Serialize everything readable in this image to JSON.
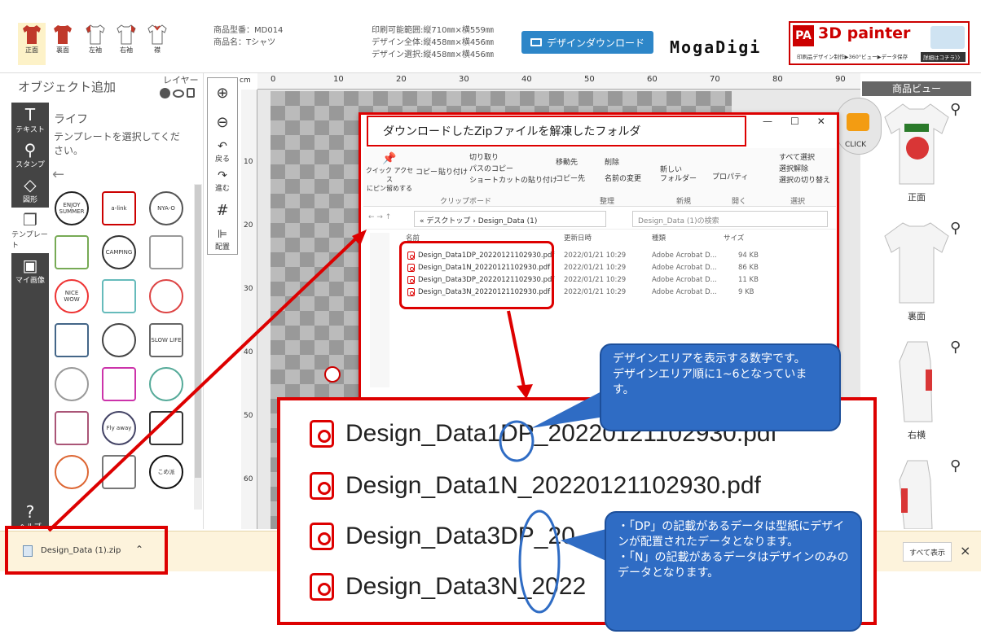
{
  "topbar": {
    "tabs": [
      {
        "label": "正面"
      },
      {
        "label": "裏面"
      },
      {
        "label": "左袖"
      },
      {
        "label": "右袖"
      },
      {
        "label": "襟"
      }
    ],
    "product_code": "商品型番：MD014",
    "product_name": "商品名：Tシャツ",
    "print_area": "印刷可能範囲:縦710㎜×横559㎜",
    "design_total": "デザイン全体:縦458㎜×横456㎜",
    "design_selected": "デザイン選択:縦458㎜×横456㎜",
    "download_button": "デザインダウンロード",
    "logo": "MogaDigi",
    "banner_pa": "PA",
    "banner_title": "3D painter",
    "banner_sub": "印刷品デザイン制作▶360°ビュー▶データ保存",
    "banner_more": "詳細はコチラ〉〉"
  },
  "left": {
    "header": "オブジェクト追加",
    "layer_label": "レイヤー",
    "tools": [
      {
        "label": "テキスト",
        "icon": "T"
      },
      {
        "label": "スタンプ",
        "icon": "⚲"
      },
      {
        "label": "図形",
        "icon": "◇"
      },
      {
        "label": "テンプレート",
        "icon": "❐"
      },
      {
        "label": "マイ画像",
        "icon": "▣"
      }
    ],
    "help_label": "ヘルプ",
    "category": "ライフ",
    "instruction": "テンプレートを選択してください。",
    "templates": [
      "ENJOY SUMMER",
      "a-link",
      "NYA-O",
      "",
      "CAMPING",
      "",
      "NICE WOW",
      "",
      "",
      "",
      "",
      "SLOW LIFE",
      "",
      "",
      "",
      "",
      "Fly away",
      "",
      "",
      "",
      "こめ派"
    ]
  },
  "zoom": {
    "zoom_in": "⊕",
    "zoom_out": "⊖",
    "undo": "戻る",
    "redo": "進む",
    "grid": "#",
    "align": "配置"
  },
  "ruler": {
    "unit": "cm",
    "top_ticks": [
      "0",
      "10",
      "20",
      "30",
      "40",
      "50",
      "60",
      "70",
      "80",
      "90"
    ],
    "left_ticks": [
      "10",
      "20",
      "30",
      "40",
      "50",
      "60"
    ]
  },
  "right": {
    "header": "商品ビュー",
    "click_badge": "CLICK",
    "views": [
      {
        "label": "正面"
      },
      {
        "label": "裏面"
      },
      {
        "label": "右横"
      },
      {
        "label": ""
      }
    ]
  },
  "bottombar": {
    "zip_name": "Design_Data (1).zip",
    "show_all": "すべて表示",
    "close": "×"
  },
  "explorer": {
    "title_box": "ダウンロードしたZipファイルを解凍したフォルダ",
    "window_controls": [
      "—",
      "☐",
      "✕"
    ],
    "ribbon": {
      "pin": "クイック アクセス\nにピン留めする",
      "copy": "コピー",
      "paste": "貼り付け",
      "cut": "切り取り",
      "copy_path": "パスのコピー",
      "paste_shortcut": "ショートカットの貼り付け",
      "move_to": "移動先",
      "copy_to": "コピー先",
      "delete": "削除",
      "rename": "名前の変更",
      "new_folder": "新しい\nフォルダー",
      "properties": "プロパティ",
      "select_all": "すべて選択",
      "select_none": "選択解除",
      "invert": "選択の切り替え",
      "groups": [
        "クリップボード",
        "整理",
        "新規",
        "開く",
        "選択"
      ]
    },
    "address": "« デスクトップ › Design_Data (1)",
    "search_placeholder": "Design_Data (1)の検索",
    "columns": [
      "名前",
      "更新日時",
      "種類",
      "サイズ"
    ],
    "files": [
      {
        "name": "Design_Data1DP_20220121102930.pdf",
        "date": "2022/01/21 10:29",
        "type": "Adobe Acrobat D...",
        "size": "94 KB"
      },
      {
        "name": "Design_Data1N_20220121102930.pdf",
        "date": "2022/01/21 10:29",
        "type": "Adobe Acrobat D...",
        "size": "86 KB"
      },
      {
        "name": "Design_Data3DP_20220121102930.pdf",
        "date": "2022/01/21 10:29",
        "type": "Adobe Acrobat D...",
        "size": "11 KB"
      },
      {
        "name": "Design_Data3N_20220121102930.pdf",
        "date": "2022/01/21 10:29",
        "type": "Adobe Acrobat D...",
        "size": "9 KB"
      }
    ]
  },
  "zoomed": {
    "rows": [
      "Design_Data1DP_20220121102930.pdf",
      "Design_Data1N_20220121102930.pdf",
      "Design_Data3DP_20",
      "Design_Data3N_2022"
    ]
  },
  "callouts": {
    "top": "デザインエリアを表示する数字です。\nデザインエリア順に1~6となっています。",
    "bottom": "・「DP」の記載があるデータは型紙にデザインが配置されたデータとなります。\n・「N」の記載があるデータはデザインのみのデータとなります。"
  },
  "colors": {
    "accent_red": "#dd0000",
    "callout_blue": "#2f6cc4",
    "download_blue": "#2d86c8",
    "shirt_red": "#c0392b"
  }
}
